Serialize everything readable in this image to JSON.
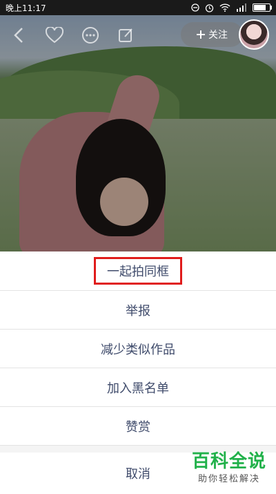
{
  "status_bar": {
    "time": "晚上11:17",
    "battery_level": 0.85
  },
  "video": {
    "follow_label": "关注"
  },
  "sheet": {
    "items": [
      "一起拍同框",
      "举报",
      "减少类似作品",
      "加入黑名单",
      "赞赏"
    ],
    "cancel": "取消",
    "highlight_color": "#e01b1b",
    "text_color": "#3f4b6b"
  },
  "watermark": {
    "title": "百科全说",
    "subtitle": "助你轻松解决"
  }
}
